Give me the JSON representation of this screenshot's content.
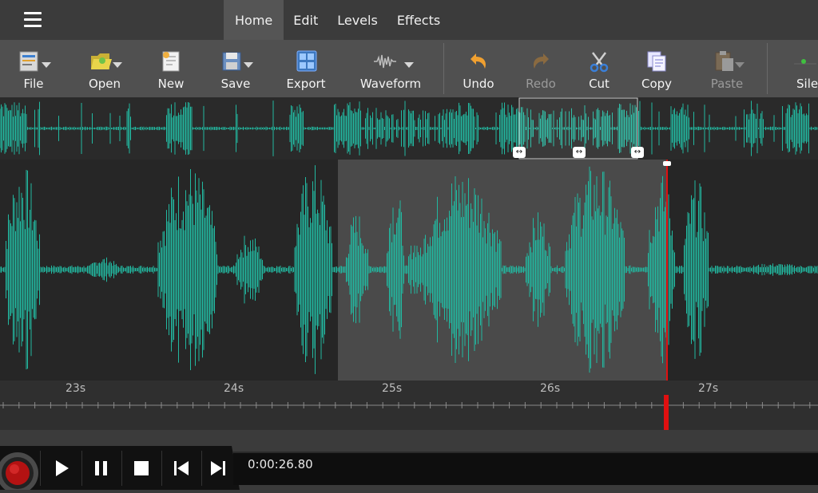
{
  "tabs": [
    {
      "label": "Home",
      "active": true
    },
    {
      "label": "Edit",
      "active": false
    },
    {
      "label": "Levels",
      "active": false
    },
    {
      "label": "Effects",
      "active": false
    }
  ],
  "toolbar": {
    "file": "File",
    "open": "Open",
    "new": "New",
    "save": "Save",
    "export": "Export",
    "waveform": "Waveform",
    "undo": "Undo",
    "redo": "Redo",
    "cut": "Cut",
    "copy": "Copy",
    "paste": "Paste",
    "silence": "Silen"
  },
  "timeline": {
    "labels": [
      "23s",
      "24s",
      "25s",
      "26s",
      "27s"
    ]
  },
  "transport": {
    "time": "0:00:26.80"
  },
  "colors": {
    "waveform": "#22b8a0",
    "playhead": "#e01010",
    "selection": "#4a4a4a"
  },
  "icons": [
    "menu-icon",
    "file-icon",
    "open-folder-icon",
    "new-file-icon",
    "save-disk-icon",
    "export-icon",
    "waveform-icon",
    "undo-icon",
    "redo-icon",
    "scissors-icon",
    "copy-icon",
    "paste-icon",
    "silence-icon",
    "record-icon",
    "play-icon",
    "pause-icon",
    "stop-icon",
    "skip-back-icon",
    "skip-forward-icon"
  ]
}
